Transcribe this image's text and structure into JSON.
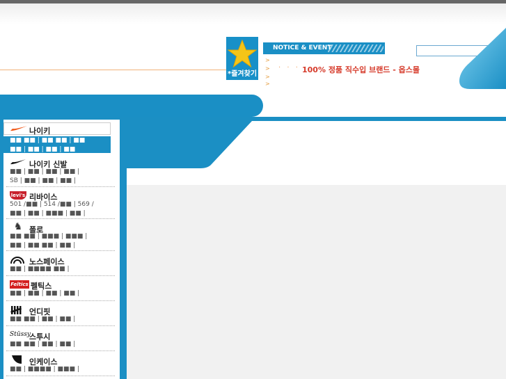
{
  "header": {
    "favorite_label": "*즐겨찾기",
    "notice_label": "NOTICE & EVENT",
    "promo_text": "100% 정품 직수입 브랜드 - 옵스몰",
    "promo_dots": "· · · ·",
    "bullets": [
      ">",
      ">",
      ">",
      ">"
    ],
    "search_placeholder": "",
    "search_button": "⊕"
  },
  "sidebar": {
    "brands": [
      {
        "name": "나이키",
        "logo": "nike-swoosh",
        "sub": "■■ ■■ | ■■ ■■ | ■■\n■■ | ■■ | ■■ | ■■"
      },
      {
        "name": "나이키 신발",
        "logo": "nike",
        "sub": "■■ | ■■ | ■■ | ■■ |\nSB | ■■ | ■■ | ■■ |"
      },
      {
        "name": "리바이스",
        "logo": "levis",
        "sub": "501 /■■ | 514 /■■ | 569 /\n■■ | ■■ | ■■■ | ■■ |"
      },
      {
        "name": "폴로",
        "logo": "polo",
        "sub": "■■ ■■ | ■■■ | ■■■ |\n■■ | ■■ ■■ | ■■ |"
      },
      {
        "name": "노스페이스",
        "logo": "northface",
        "sub": "■■ | ■■■■ ■■ |"
      },
      {
        "name": "펠틱스",
        "logo": "feltics",
        "sub": "■■ | ■■ | ■■ | ■■ |"
      },
      {
        "name": "언디핏",
        "logo": "undefeated",
        "sub": "■■ ■■ | ■■ | ■■ |"
      },
      {
        "name": "스투시",
        "logo": "stussy",
        "sub": "■■ ■■ | ■■ | ■■ |"
      },
      {
        "name": "인케이스",
        "logo": "incase",
        "sub": "■■ | ■■■■ | ■■■ |"
      }
    ]
  },
  "colors": {
    "accent": "#1a8fc5",
    "promo": "#d63b2b",
    "star": "#f5c518"
  }
}
